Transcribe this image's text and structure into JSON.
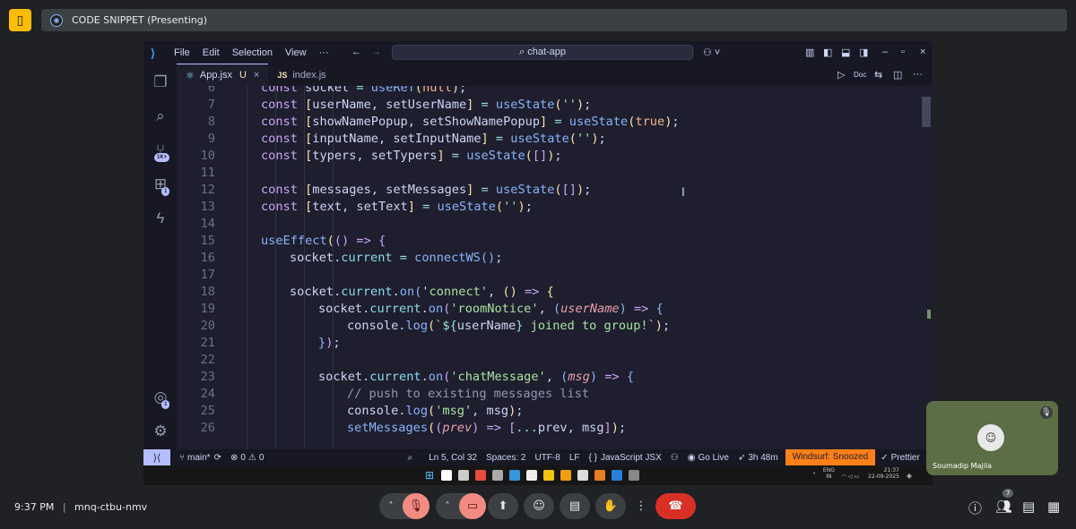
{
  "meet": {
    "presenting_title": "CODE SNIPPET (Presenting)",
    "time": "9:37 PM",
    "separator": "|",
    "meeting_code": "mnq-ctbu-nmv",
    "participant_count": "7",
    "participant_name": "Soumadip Majila",
    "accent": "#fbbc04",
    "end_call_color": "#d93025"
  },
  "vscode": {
    "menu": [
      "File",
      "Edit",
      "Selection",
      "View",
      "···"
    ],
    "command_center": "chat-app",
    "tabs": [
      {
        "label": "App.jsx",
        "status": "U",
        "close": "×"
      },
      {
        "label": "index.js",
        "close": ""
      }
    ],
    "editor_action_doc": "Doc",
    "activity_badges": {
      "source_control": "1K+",
      "extensions": "1",
      "accounts": "1"
    },
    "status": {
      "branch": "main*",
      "errors": "0",
      "warnings": "0",
      "position": "Ln 5, Col 32",
      "spaces": "Spaces: 2",
      "encoding": "UTF-8",
      "eol": "LF",
      "language": "JavaScript JSX",
      "golive": "Go Live",
      "time": "3h 48m",
      "windsurf": "Windsurf: Snoozed",
      "prettier": "Prettier"
    },
    "lines": [
      {
        "n": "6",
        "indent": 1,
        "tokens": [
          [
            "kw",
            "const "
          ],
          [
            "",
            "socket "
          ],
          [
            "op",
            "= "
          ],
          [
            "fn",
            "useRef"
          ],
          [
            "br1",
            "("
          ],
          [
            "bool",
            "null"
          ],
          [
            "br1",
            ")"
          ],
          [
            "",
            ";"
          ]
        ]
      },
      {
        "n": "7",
        "indent": 1,
        "tokens": [
          [
            "kw",
            "const "
          ],
          [
            "br1",
            "["
          ],
          [
            "",
            "userName, setUserName"
          ],
          [
            "br1",
            "]"
          ],
          [
            "op",
            " = "
          ],
          [
            "fn",
            "useState"
          ],
          [
            "br1",
            "("
          ],
          [
            "st",
            "''"
          ],
          [
            "br1",
            ")"
          ],
          [
            "",
            ";"
          ]
        ]
      },
      {
        "n": "8",
        "indent": 1,
        "tokens": [
          [
            "kw",
            "const "
          ],
          [
            "br1",
            "["
          ],
          [
            "",
            "showNamePopup, setShowNamePopup"
          ],
          [
            "br1",
            "]"
          ],
          [
            "op",
            " = "
          ],
          [
            "fn",
            "useState"
          ],
          [
            "br1",
            "("
          ],
          [
            "bool",
            "true"
          ],
          [
            "br1",
            ")"
          ],
          [
            "",
            ";"
          ]
        ]
      },
      {
        "n": "9",
        "indent": 1,
        "tokens": [
          [
            "kw",
            "const "
          ],
          [
            "br1",
            "["
          ],
          [
            "",
            "inputName, setInputName"
          ],
          [
            "br1",
            "]"
          ],
          [
            "op",
            " = "
          ],
          [
            "fn",
            "useState"
          ],
          [
            "br1",
            "("
          ],
          [
            "st",
            "''"
          ],
          [
            "br1",
            ")"
          ],
          [
            "",
            ";"
          ]
        ]
      },
      {
        "n": "10",
        "indent": 1,
        "tokens": [
          [
            "kw",
            "const "
          ],
          [
            "br1",
            "["
          ],
          [
            "",
            "typers, setTypers"
          ],
          [
            "br1",
            "]"
          ],
          [
            "op",
            " = "
          ],
          [
            "fn",
            "useState"
          ],
          [
            "br1",
            "("
          ],
          [
            "br2",
            "[]"
          ],
          [
            "br1",
            ")"
          ],
          [
            "",
            ";"
          ]
        ]
      },
      {
        "n": "11",
        "indent": 0,
        "tokens": []
      },
      {
        "n": "12",
        "indent": 1,
        "tokens": [
          [
            "kw",
            "const "
          ],
          [
            "br1",
            "["
          ],
          [
            "",
            "messages, setMessages"
          ],
          [
            "br1",
            "]"
          ],
          [
            "op",
            " = "
          ],
          [
            "fn",
            "useState"
          ],
          [
            "br1",
            "("
          ],
          [
            "br2",
            "[]"
          ],
          [
            "br1",
            ")"
          ],
          [
            "",
            ";"
          ]
        ]
      },
      {
        "n": "13",
        "indent": 1,
        "tokens": [
          [
            "kw",
            "const "
          ],
          [
            "br1",
            "["
          ],
          [
            "",
            "text, setText"
          ],
          [
            "br1",
            "]"
          ],
          [
            "op",
            " = "
          ],
          [
            "fn",
            "useState"
          ],
          [
            "br1",
            "("
          ],
          [
            "st",
            "''"
          ],
          [
            "br1",
            ")"
          ],
          [
            "",
            ";"
          ]
        ]
      },
      {
        "n": "14",
        "indent": 0,
        "tokens": []
      },
      {
        "n": "15",
        "indent": 1,
        "tokens": [
          [
            "fn",
            "useEffect"
          ],
          [
            "br1",
            "("
          ],
          [
            "br2",
            "()"
          ],
          [
            "kw",
            " => "
          ],
          [
            "br2",
            "{"
          ]
        ]
      },
      {
        "n": "16",
        "indent": 2,
        "tokens": [
          [
            "",
            "socket."
          ],
          [
            "pr",
            "current"
          ],
          [
            "op",
            " = "
          ],
          [
            "fn",
            "connectWS"
          ],
          [
            "br3",
            "()"
          ],
          [
            "",
            ";"
          ]
        ]
      },
      {
        "n": "17",
        "indent": 0,
        "tokens": []
      },
      {
        "n": "18",
        "indent": 2,
        "tokens": [
          [
            "",
            "socket."
          ],
          [
            "pr",
            "current"
          ],
          [
            "",
            "."
          ],
          [
            "fn",
            "on"
          ],
          [
            "br3",
            "("
          ],
          [
            "st",
            "'connect'"
          ],
          [
            "",
            ", "
          ],
          [
            "br1",
            "()"
          ],
          [
            "kw",
            " => "
          ],
          [
            "br1",
            "{"
          ]
        ]
      },
      {
        "n": "19",
        "indent": 3,
        "tokens": [
          [
            "",
            "socket."
          ],
          [
            "pr",
            "current"
          ],
          [
            "",
            "."
          ],
          [
            "fn",
            "on"
          ],
          [
            "br2",
            "("
          ],
          [
            "st",
            "'roomNotice'"
          ],
          [
            "",
            ", "
          ],
          [
            "br3",
            "("
          ],
          [
            "pa",
            "userName"
          ],
          [
            "br3",
            ")"
          ],
          [
            "kw",
            " => "
          ],
          [
            "br3",
            "{"
          ]
        ]
      },
      {
        "n": "20",
        "indent": 4,
        "tokens": [
          [
            "",
            "console."
          ],
          [
            "fn",
            "log"
          ],
          [
            "br1",
            "("
          ],
          [
            "st",
            "`"
          ],
          [
            "op",
            "${"
          ],
          [
            "",
            "userName"
          ],
          [
            "op",
            "}"
          ],
          [
            "st",
            " joined to group!`"
          ],
          [
            "br1",
            ")"
          ],
          [
            "",
            ";"
          ]
        ]
      },
      {
        "n": "21",
        "indent": 3,
        "tokens": [
          [
            "br3",
            "}"
          ],
          [
            "br2",
            ")"
          ],
          [
            "",
            ";"
          ]
        ]
      },
      {
        "n": "22",
        "indent": 0,
        "tokens": []
      },
      {
        "n": "23",
        "indent": 3,
        "tokens": [
          [
            "",
            "socket."
          ],
          [
            "pr",
            "current"
          ],
          [
            "",
            "."
          ],
          [
            "fn",
            "on"
          ],
          [
            "br2",
            "("
          ],
          [
            "st",
            "'chatMessage'"
          ],
          [
            "",
            ", "
          ],
          [
            "br3",
            "("
          ],
          [
            "pa",
            "msg"
          ],
          [
            "br3",
            ")"
          ],
          [
            "kw",
            " => "
          ],
          [
            "br3",
            "{"
          ]
        ]
      },
      {
        "n": "24",
        "indent": 4,
        "tokens": [
          [
            "cm",
            "// push to existing messages list"
          ]
        ]
      },
      {
        "n": "25",
        "indent": 4,
        "tokens": [
          [
            "",
            "console."
          ],
          [
            "fn",
            "log"
          ],
          [
            "br1",
            "("
          ],
          [
            "st",
            "'msg'"
          ],
          [
            "",
            ", msg"
          ],
          [
            "br1",
            ")"
          ],
          [
            "",
            ";"
          ]
        ]
      },
      {
        "n": "26",
        "indent": 4,
        "tokens": [
          [
            "fn",
            "setMessages"
          ],
          [
            "br1",
            "("
          ],
          [
            "br2",
            "("
          ],
          [
            "pa",
            "prev"
          ],
          [
            "br2",
            ")"
          ],
          [
            "kw",
            " => "
          ],
          [
            "br2",
            "["
          ],
          [
            "op",
            "..."
          ],
          [
            "",
            "prev, msg"
          ],
          [
            "br2",
            "]"
          ],
          [
            "br1",
            ")"
          ],
          [
            "",
            ";"
          ]
        ]
      }
    ]
  },
  "taskbar": {
    "lang": "ENG",
    "region": "IN",
    "time": "21:37",
    "date": "22-09-2025"
  }
}
